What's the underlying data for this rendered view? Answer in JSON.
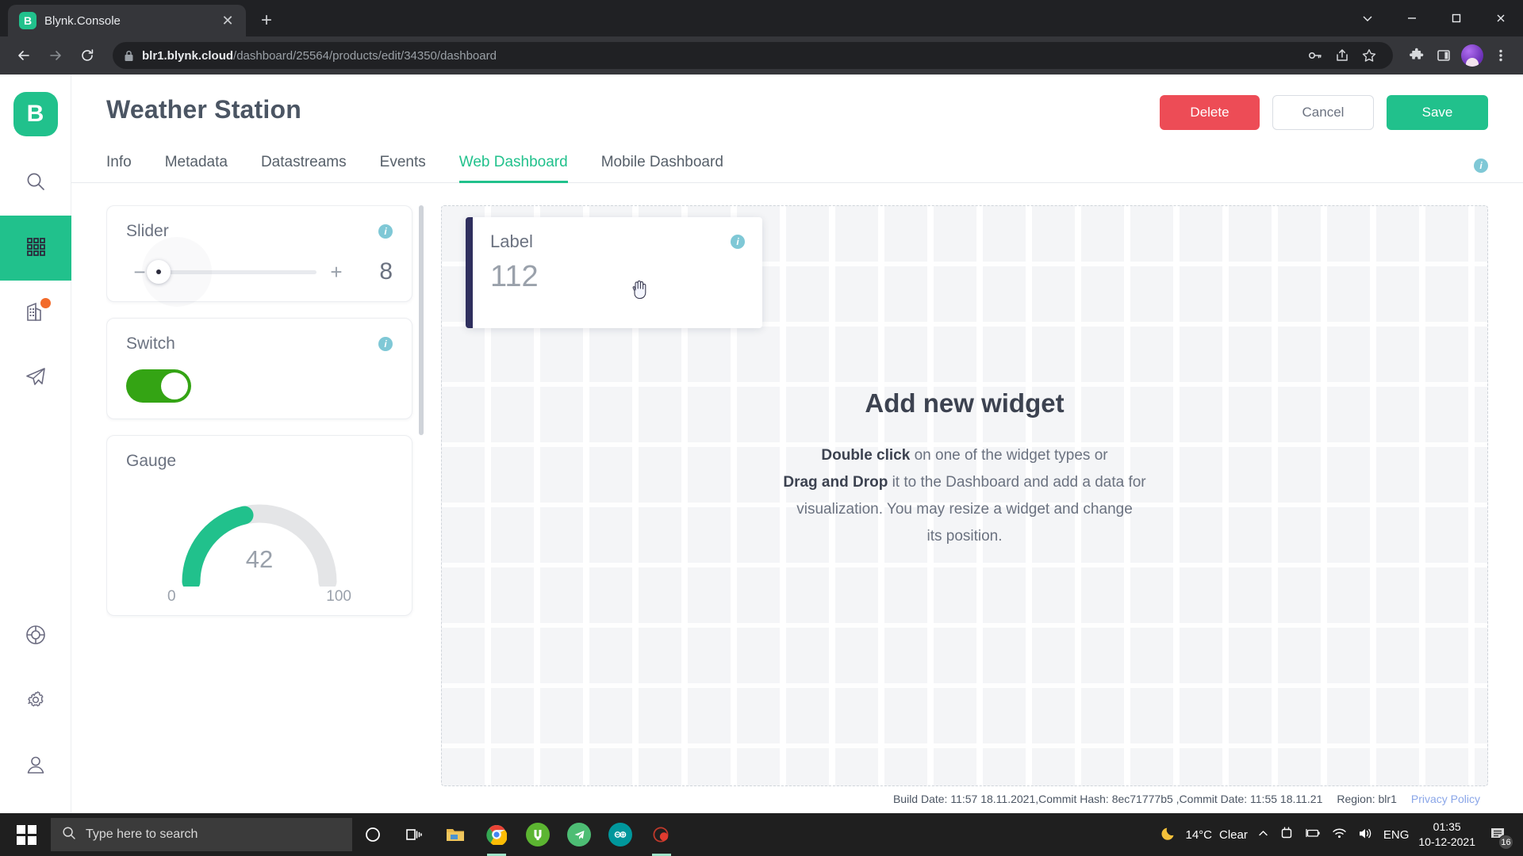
{
  "browser": {
    "tab": {
      "title": "Blynk.Console",
      "favicon_letter": "B",
      "favicon_icon": "blynk-logo-icon",
      "close_icon": "close-icon"
    },
    "new_tab_icon": "new-tab-icon",
    "window_controls": {
      "minimize_icon": "minimize-icon",
      "maximize_icon": "maximize-icon",
      "close_icon": "window-close-icon",
      "collapse_icon": "chevron-down-icon"
    },
    "nav": {
      "back_icon": "back-arrow-icon",
      "forward_icon": "forward-arrow-icon",
      "reload_icon": "reload-icon"
    },
    "omnibox": {
      "lock_icon": "lock-icon",
      "url_host": "blr1.blynk.cloud",
      "url_path": "/dashboard/25564/products/edit/34350/dashboard",
      "key_icon": "key-icon",
      "share_icon": "share-icon",
      "bookmark_icon": "star-icon"
    },
    "toolbar_icons": {
      "extensions_icon": "puzzle-icon",
      "side_panel_icon": "side-panel-icon",
      "profile_icon": "avatar-icon",
      "menu_icon": "three-dot-menu-icon"
    }
  },
  "sidebar": {
    "logo_letter": "B",
    "items": [
      {
        "name": "search",
        "icon": "search-icon",
        "active": false
      },
      {
        "name": "devices",
        "icon": "grid-icon",
        "active": true
      },
      {
        "name": "organizations",
        "icon": "building-icon",
        "active": false,
        "badge": true
      },
      {
        "name": "send",
        "icon": "paper-plane-icon",
        "active": false
      },
      {
        "name": "support",
        "icon": "lifebuoy-icon",
        "active": false
      },
      {
        "name": "settings",
        "icon": "gear-icon",
        "active": false
      },
      {
        "name": "account",
        "icon": "user-icon",
        "active": false
      }
    ]
  },
  "header": {
    "title": "Weather Station",
    "buttons": {
      "delete": "Delete",
      "cancel": "Cancel",
      "save": "Save"
    }
  },
  "tabs": {
    "items": [
      "Info",
      "Metadata",
      "Datastreams",
      "Events",
      "Web Dashboard",
      "Mobile Dashboard"
    ],
    "active_index": 4,
    "info_icon": "info-icon"
  },
  "palette": {
    "widgets": [
      {
        "type": "slider",
        "name": "Slider",
        "value": "8",
        "minus_label": "−",
        "plus_label": "+",
        "info_icon": "info-icon"
      },
      {
        "type": "switch",
        "name": "Switch",
        "state": "on",
        "info_icon": "info-icon"
      },
      {
        "type": "gauge",
        "name": "Gauge",
        "value": "42",
        "min": "0",
        "max": "100",
        "info_icon": "info-icon"
      }
    ]
  },
  "dashboard": {
    "widget": {
      "name": "Label",
      "value": "112",
      "info_icon": "info-icon",
      "accent_color": "#2f2f5e",
      "cursor_icon": "grab-hand-cursor-icon"
    },
    "empty_state": {
      "title": "Add new widget",
      "line1_bold": "Double click",
      "line1_rest": " on one of the widget types or",
      "line2_bold": "Drag and Drop",
      "line2_rest": " it to the Dashboard and add a data for",
      "line3": "visualization. You may resize a widget and change",
      "line4": "its position."
    }
  },
  "footer": {
    "build_info": "Build Date: 11:57 18.11.2021,Commit Hash: 8ec71777b5 ,Commit Date: 11:55 18.11.21",
    "region": "Region: blr1",
    "privacy": "Privacy Policy"
  },
  "taskbar": {
    "start_icon": "windows-start-icon",
    "search_placeholder": "Type here to search",
    "search_icon": "search-icon",
    "cortana_icon": "cortana-circle-icon",
    "taskview_icon": "task-view-icon",
    "apps": [
      {
        "name": "file-explorer",
        "icon": "folder-icon"
      },
      {
        "name": "google-chrome",
        "icon": "chrome-icon"
      },
      {
        "name": "utorrent",
        "icon": "utorrent-icon"
      },
      {
        "name": "telegram",
        "icon": "telegram-icon"
      },
      {
        "name": "arduino-ide",
        "icon": "arduino-icon"
      },
      {
        "name": "app-red",
        "icon": "red-app-icon"
      }
    ],
    "tray": {
      "weather_icon": "moon-icon",
      "temperature": "14°C",
      "condition": "Clear",
      "overflow_icon": "chevron-up-icon",
      "device_icon": "device-icon",
      "battery_icon": "battery-icon",
      "wifi_icon": "wifi-icon",
      "volume_icon": "volume-icon",
      "language": "ENG",
      "time": "01:35",
      "date": "10-12-2021",
      "notification_icon": "notification-icon",
      "notification_count": "16"
    }
  },
  "colors": {
    "brand_green": "#21c18c",
    "delete_red": "#ed4c56",
    "switch_green": "#34a414",
    "label_accent": "#2f2f5e",
    "info_teal": "#7fc8d6"
  }
}
